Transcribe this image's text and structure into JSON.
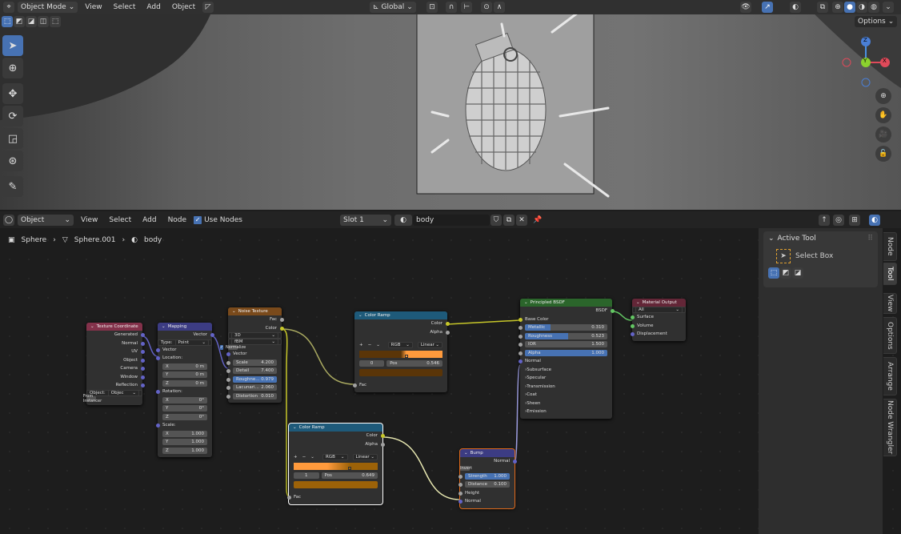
{
  "viewport_header": {
    "mode": "Object Mode",
    "menus": [
      "View",
      "Select",
      "Add",
      "Object"
    ],
    "orientation": "Global",
    "options": "Options"
  },
  "gizmo": {
    "z": "Z",
    "y": "Y",
    "x": "X"
  },
  "node_header": {
    "type": "Object",
    "menus": [
      "View",
      "Select",
      "Add",
      "Node"
    ],
    "use_nodes": "Use Nodes",
    "use_nodes_checked": true,
    "slot": "Slot 1",
    "material": "body"
  },
  "breadcrumb": [
    "Sphere",
    "Sphere.001",
    "body"
  ],
  "sidebar": {
    "panel": "Active Tool",
    "tool": "Select Box",
    "tabs": [
      "Node",
      "Tool",
      "View",
      "Options",
      "Arrange",
      "Node Wrangler"
    ],
    "active_tab": "Tool"
  },
  "colors": {
    "accent": "#4772b3",
    "vector_socket": "#6363c7",
    "color_socket": "#c7c729",
    "float_socket": "#a1a1a1",
    "shader_socket": "#63c763"
  },
  "nodes": [
    {
      "id": "texcoord",
      "title": "Texture Coordinate",
      "color": "#83314a",
      "rows": [
        {
          "t": "out",
          "label": "Generated",
          "s": "vec"
        },
        {
          "t": "out",
          "label": "Normal",
          "s": "vec"
        },
        {
          "t": "out",
          "label": "UV",
          "s": "vec"
        },
        {
          "t": "out",
          "label": "Object",
          "s": "vec"
        },
        {
          "t": "out",
          "label": "Camera",
          "s": "vec"
        },
        {
          "t": "out",
          "label": "Window",
          "s": "vec"
        },
        {
          "t": "out",
          "label": "Reflection",
          "s": "vec"
        },
        {
          "t": "dd",
          "label": "Object:",
          "value": "Objec"
        },
        {
          "t": "chk",
          "label": "From Instancer",
          "on": false
        }
      ]
    },
    {
      "id": "mapping",
      "title": "Mapping",
      "color": "#3c3c83",
      "rows": [
        {
          "t": "out",
          "label": "Vector",
          "s": "vec"
        },
        {
          "t": "dd",
          "label": "Type:",
          "value": "Point"
        },
        {
          "t": "in",
          "label": "Vector",
          "s": "vec"
        },
        {
          "t": "in",
          "label": "Location:",
          "s": "vec"
        },
        {
          "t": "fld",
          "label": "X",
          "value": "0 m"
        },
        {
          "t": "fld",
          "label": "Y",
          "value": "0 m"
        },
        {
          "t": "fld",
          "label": "Z",
          "value": "0 m"
        },
        {
          "t": "in",
          "label": "Rotation:",
          "s": "vec"
        },
        {
          "t": "fld",
          "label": "X",
          "value": "0°"
        },
        {
          "t": "fld",
          "label": "Y",
          "value": "0°"
        },
        {
          "t": "fld",
          "label": "Z",
          "value": "0°"
        },
        {
          "t": "in",
          "label": "Scale:",
          "s": "vec"
        },
        {
          "t": "fld",
          "label": "X",
          "value": "1.000"
        },
        {
          "t": "fld",
          "label": "Y",
          "value": "1.000"
        },
        {
          "t": "fld",
          "label": "Z",
          "value": "1.000"
        }
      ]
    },
    {
      "id": "noise",
      "title": "Noise Texture",
      "color": "#7a4a1b",
      "rows": [
        {
          "t": "out",
          "label": "Fac",
          "s": "flt"
        },
        {
          "t": "out",
          "label": "Color",
          "s": "col"
        },
        {
          "t": "dd",
          "value": "3D"
        },
        {
          "t": "dd",
          "value": "fBM"
        },
        {
          "t": "chk",
          "label": "Normalize",
          "on": true
        },
        {
          "t": "in",
          "label": "Vector",
          "s": "vec"
        },
        {
          "t": "fld",
          "label": "Scale",
          "value": "4.200",
          "s": "flt"
        },
        {
          "t": "fld",
          "label": "Detail",
          "value": "7.400",
          "s": "flt"
        },
        {
          "t": "fld",
          "label": "Roughne...",
          "value": "0.979",
          "s": "flt",
          "fill": 1
        },
        {
          "t": "fld",
          "label": "Lacunari...",
          "value": "2.060",
          "s": "flt"
        },
        {
          "t": "fld",
          "label": "Distortion",
          "value": "0.010",
          "s": "flt"
        }
      ]
    },
    {
      "id": "ramp1",
      "title": "Color Ramp",
      "color": "#1e5a7a",
      "rows": [
        {
          "t": "out",
          "label": "Color",
          "s": "col"
        },
        {
          "t": "out",
          "label": "Alpha",
          "s": "flt"
        },
        {
          "t": "ramp",
          "mode": "RGB",
          "interp": "Linear",
          "index": "0",
          "pos_label": "Pos",
          "pos": "0.546",
          "c0": "#5a3508",
          "c1": "#ff9a3c",
          "stop": 0.546,
          "swatch": "#5a3508",
          "grad": 0.55
        },
        {
          "t": "in",
          "label": "Fac",
          "s": "flt"
        }
      ]
    },
    {
      "id": "ramp2",
      "title": "Color Ramp",
      "color": "#1e5a7a",
      "rows": [
        {
          "t": "out",
          "label": "Color",
          "s": "col"
        },
        {
          "t": "out",
          "label": "Alpha",
          "s": "flt"
        },
        {
          "t": "ramp",
          "mode": "RGB",
          "interp": "Linear",
          "index": "1",
          "pos_label": "Pos",
          "pos": "0.649",
          "c0": "#ff9a3c",
          "c1": "#9c6208",
          "stop": 0.649,
          "swatch": "#9c6208",
          "grad": 0.45
        },
        {
          "t": "in",
          "label": "Fac",
          "s": "flt"
        }
      ]
    },
    {
      "id": "bsdf",
      "title": "Principled BSDF",
      "color": "#2b652b",
      "rows": [
        {
          "t": "out",
          "label": "BSDF",
          "s": "sh"
        },
        {
          "t": "in",
          "label": "Base Color",
          "s": "col"
        },
        {
          "t": "fld",
          "label": "Metallic",
          "value": "0.310",
          "s": "flt",
          "fill": 0.31
        },
        {
          "t": "fld",
          "label": "Roughness",
          "value": "0.523",
          "s": "flt",
          "fill": 0.523
        },
        {
          "t": "fld",
          "label": "IOR",
          "value": "1.500",
          "s": "flt"
        },
        {
          "t": "fld",
          "label": "Alpha",
          "value": "1.000",
          "s": "flt",
          "fill": 1
        },
        {
          "t": "in",
          "label": "Normal",
          "s": "vec"
        },
        {
          "t": "panel",
          "label": "Subsurface"
        },
        {
          "t": "panel",
          "label": "Specular"
        },
        {
          "t": "panel",
          "label": "Transmission"
        },
        {
          "t": "panel",
          "label": "Coat"
        },
        {
          "t": "panel",
          "label": "Sheen"
        },
        {
          "t": "panel",
          "label": "Emission"
        }
      ]
    },
    {
      "id": "output",
      "title": "Material Output",
      "color": "#632637",
      "rows": [
        {
          "t": "dd",
          "value": "All"
        },
        {
          "t": "in",
          "label": "Surface",
          "s": "sh"
        },
        {
          "t": "in",
          "label": "Volume",
          "s": "sh"
        },
        {
          "t": "in",
          "label": "Displacement",
          "s": "vec"
        }
      ]
    },
    {
      "id": "bump",
      "title": "Bump",
      "color": "#3c3c83",
      "rows": [
        {
          "t": "out",
          "label": "Normal",
          "s": "vec"
        },
        {
          "t": "chk",
          "label": "Invert",
          "on": false
        },
        {
          "t": "fld",
          "label": "Strength",
          "value": "1.000",
          "s": "flt",
          "fill": 1
        },
        {
          "t": "fld",
          "label": "Distance",
          "value": "0.100",
          "s": "flt"
        },
        {
          "t": "in",
          "label": "Height",
          "s": "flt"
        },
        {
          "t": "in",
          "label": "Normal",
          "s": "vec"
        }
      ]
    }
  ]
}
